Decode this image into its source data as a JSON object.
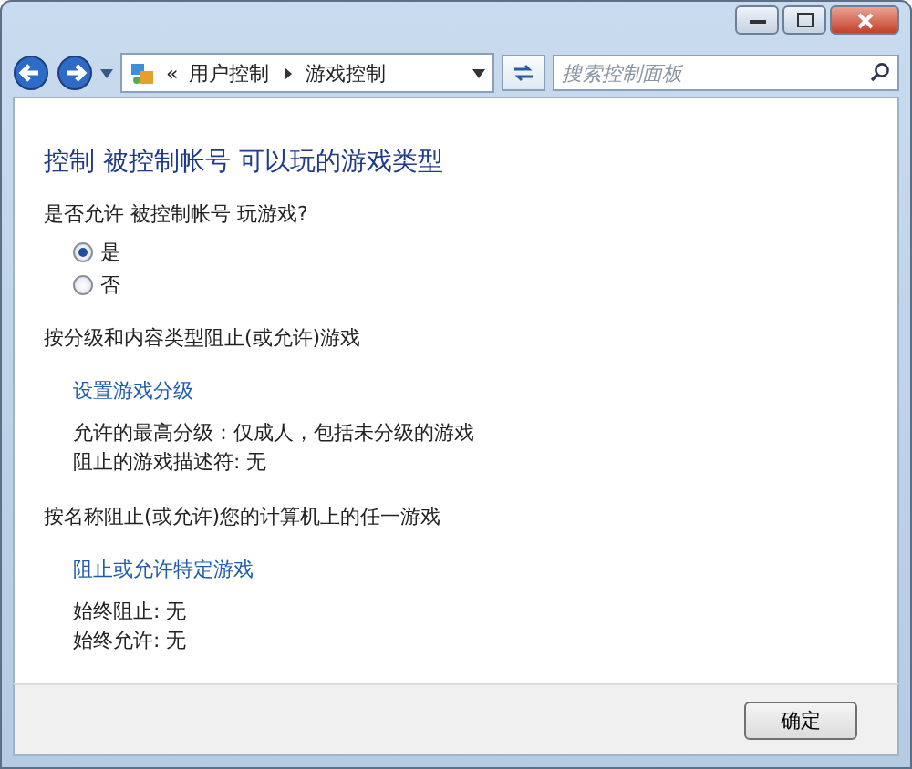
{
  "address_bar": {
    "prefix": "«",
    "path": [
      {
        "label": "用户控制"
      },
      {
        "label": "游戏控制"
      }
    ]
  },
  "search": {
    "placeholder": "搜索控制面板"
  },
  "title": "控制 被控制帐号 可以玩的游戏类型",
  "question": "是否允许 被控制帐号 玩游戏?",
  "options": [
    {
      "label": "是",
      "selected": true
    },
    {
      "label": "否",
      "selected": false
    }
  ],
  "sections": [
    {
      "heading": "按分级和内容类型阻止(或允许)游戏",
      "link": "设置游戏分级",
      "details": [
        "允许的最高分级：仅成人，包括未分级的游戏",
        "阻止的游戏描述符: 无"
      ]
    },
    {
      "heading": "按名称阻止(或允许)您的计算机上的任一游戏",
      "link": "阻止或允许特定游戏",
      "details": [
        "始终阻止: 无",
        "始终允许: 无"
      ]
    }
  ],
  "buttons": [
    "确定"
  ]
}
